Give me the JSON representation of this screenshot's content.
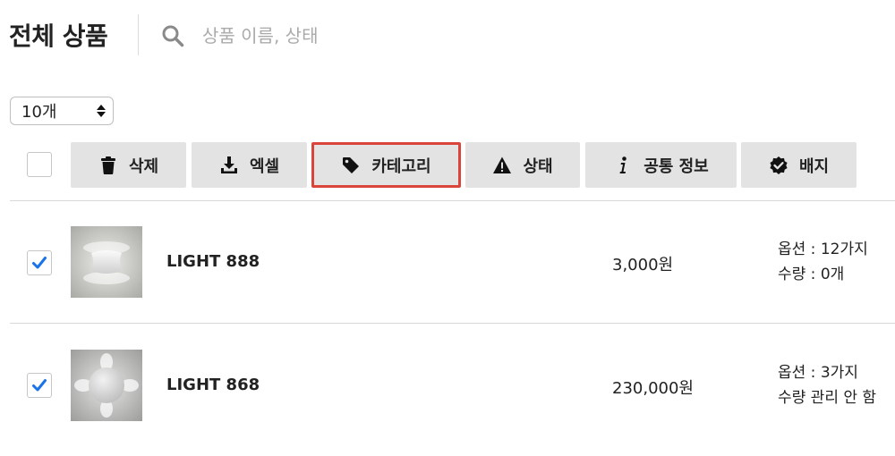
{
  "header": {
    "title": "전체 상품",
    "search_placeholder": "상품 이름, 상태"
  },
  "page_size": {
    "selected": "10개"
  },
  "toolbar": {
    "buttons": [
      {
        "label": "삭제",
        "icon": "trash-icon"
      },
      {
        "label": "엑셀",
        "icon": "download-icon"
      },
      {
        "label": "카테고리",
        "icon": "tag-icon",
        "active": true
      },
      {
        "label": "상태",
        "icon": "warning-icon"
      },
      {
        "label": "공통 정보",
        "icon": "info-icon"
      },
      {
        "label": "배지",
        "icon": "badge-check-icon"
      }
    ],
    "active_color": "#d9453a"
  },
  "products": [
    {
      "checked": true,
      "name": "LIGHT 888",
      "price": "3,000원",
      "option_line1": "옵션 : 12가지",
      "option_line2": "수량 : 0개"
    },
    {
      "checked": true,
      "name": "LIGHT 868",
      "price": "230,000원",
      "option_line1": "옵션 : 3가지",
      "option_line2": "수량 관리 안 함"
    }
  ],
  "colors": {
    "checkmark": "#1a73e8",
    "button_bg": "#e3e3e3"
  }
}
